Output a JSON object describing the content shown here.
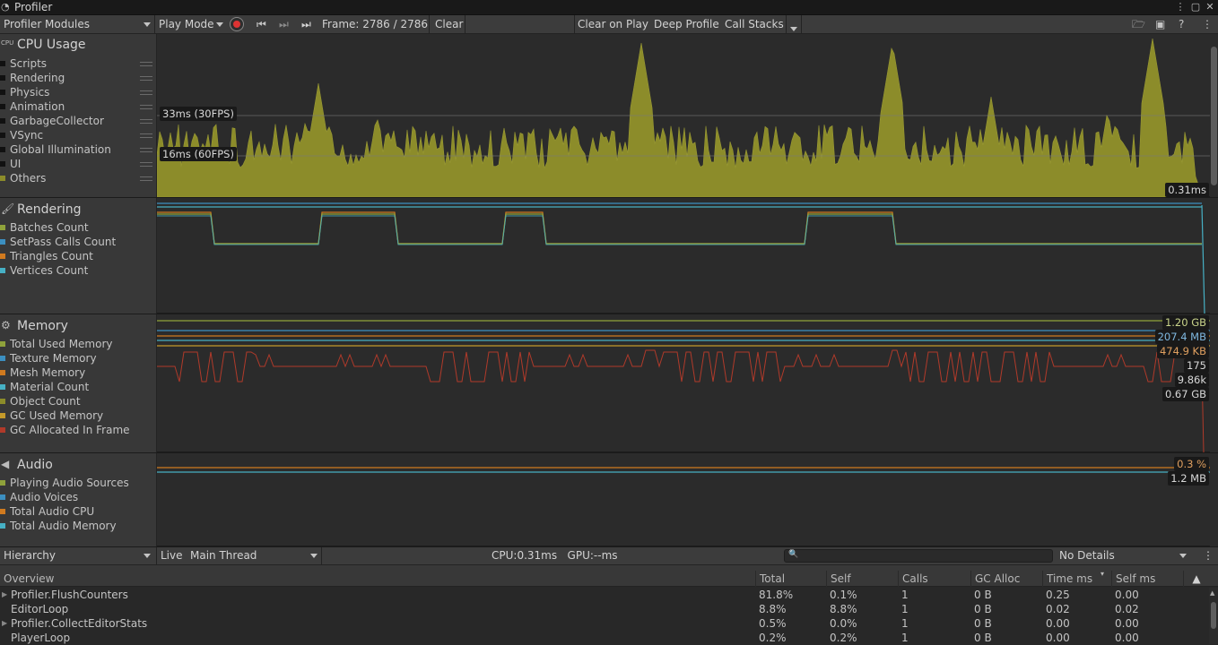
{
  "window": {
    "title": "Profiler"
  },
  "toolbar": {
    "modules_label": "Profiler Modules",
    "play_mode": "Play Mode",
    "frame": "Frame: 2786 / 2786",
    "clear": "Clear",
    "clear_on_play": "Clear on Play",
    "deep_profile": "Deep Profile",
    "call_stacks": "Call Stacks"
  },
  "modules": {
    "cpu": {
      "title": "CPU Usage",
      "items": [
        {
          "label": "Scripts",
          "color": "#111111"
        },
        {
          "label": "Rendering",
          "color": "#111111"
        },
        {
          "label": "Physics",
          "color": "#111111"
        },
        {
          "label": "Animation",
          "color": "#111111"
        },
        {
          "label": "GarbageCollector",
          "color": "#111111"
        },
        {
          "label": "VSync",
          "color": "#111111"
        },
        {
          "label": "Global Illumination",
          "color": "#111111"
        },
        {
          "label": "UI",
          "color": "#111111"
        },
        {
          "label": "Others",
          "color": "#8c8c2a"
        }
      ],
      "label_33": "33ms (30FPS)",
      "label_16": "16ms (60FPS)",
      "current": "0.31ms"
    },
    "rendering": {
      "title": "Rendering",
      "items": [
        {
          "label": "Batches Count",
          "color": "#8fa23b"
        },
        {
          "label": "SetPass Calls Count",
          "color": "#3c8fc0"
        },
        {
          "label": "Triangles Count",
          "color": "#d07a1f"
        },
        {
          "label": "Vertices Count",
          "color": "#46b0c4"
        }
      ]
    },
    "memory": {
      "title": "Memory",
      "items": [
        {
          "label": "Total Used Memory",
          "color": "#8fa23b"
        },
        {
          "label": "Texture Memory",
          "color": "#3c8fc0"
        },
        {
          "label": "Mesh Memory",
          "color": "#d07a1f"
        },
        {
          "label": "Material Count",
          "color": "#46b0c4"
        },
        {
          "label": "Object Count",
          "color": "#8c8c2a"
        },
        {
          "label": "GC Used Memory",
          "color": "#c49a2a"
        },
        {
          "label": "GC Allocated In Frame",
          "color": "#b03a2a"
        }
      ],
      "values": [
        "1.20 GB",
        "207.4 MB",
        "474.9 KB",
        "175",
        "9.86k",
        "0.67 GB"
      ]
    },
    "audio": {
      "title": "Audio",
      "items": [
        {
          "label": "Playing Audio Sources",
          "color": "#8fa23b"
        },
        {
          "label": "Audio Voices",
          "color": "#3c8fc0"
        },
        {
          "label": "Total Audio CPU",
          "color": "#d07a1f"
        },
        {
          "label": "Total Audio Memory",
          "color": "#46b0c4"
        }
      ],
      "values": [
        "0.3 %",
        "1.2 MB"
      ]
    }
  },
  "hierarchy_bar": {
    "view": "Hierarchy",
    "live": "Live",
    "thread": "Main Thread",
    "cpu_gpu": "CPU:0.31ms   GPU:--ms",
    "details": "No Details"
  },
  "table": {
    "headers": [
      "Overview",
      "Total",
      "Self",
      "Calls",
      "GC Alloc",
      "Time ms",
      "Self ms"
    ],
    "rows": [
      {
        "name": "Profiler.FlushCounters",
        "expand": true,
        "total": "81.8%",
        "self": "0.1%",
        "calls": "1",
        "gc": "0 B",
        "time": "0.25",
        "selfms": "0.00"
      },
      {
        "name": "EditorLoop",
        "expand": false,
        "total": "8.8%",
        "self": "8.8%",
        "calls": "1",
        "gc": "0 B",
        "time": "0.02",
        "selfms": "0.02"
      },
      {
        "name": "Profiler.CollectEditorStats",
        "expand": true,
        "total": "0.5%",
        "self": "0.0%",
        "calls": "1",
        "gc": "0 B",
        "time": "0.00",
        "selfms": "0.00"
      },
      {
        "name": "PlayerLoop",
        "expand": false,
        "total": "0.2%",
        "self": "0.2%",
        "calls": "1",
        "gc": "0 B",
        "time": "0.00",
        "selfms": "0.00"
      }
    ]
  }
}
